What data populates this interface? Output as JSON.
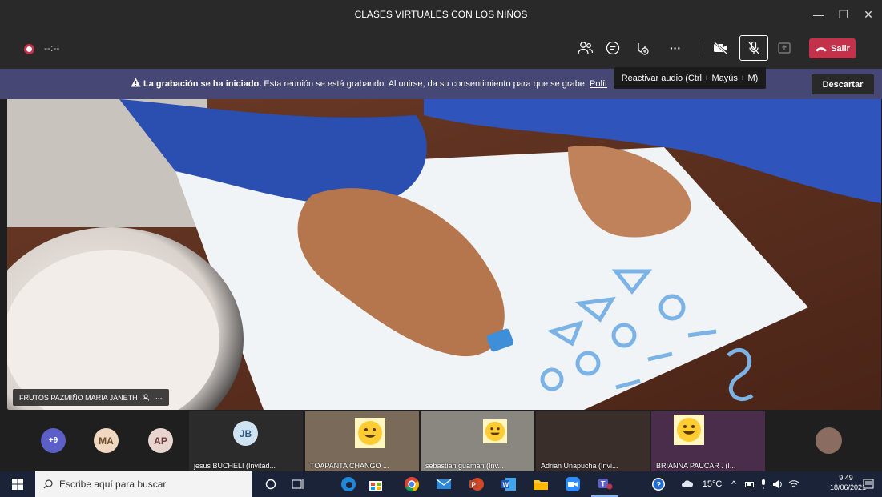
{
  "window": {
    "title": "CLASES VIRTUALES CON LOS NIÑOS",
    "minimize": "—",
    "maximize": "❐",
    "close": "✕"
  },
  "toolbar": {
    "recording_time": "--:--",
    "leave_label": "Salir",
    "more_label": "···"
  },
  "banner": {
    "bold": "La grabación se ha iniciado.",
    "text": " Esta reunión se está grabando. Al unirse, da su consentimiento para que se grabe. ",
    "link": "Polít",
    "dismiss": "Descartar"
  },
  "tooltip": "Reactivar audio (Ctrl + Mayús + M)",
  "main_video": {
    "participant": "FRUTOS PAZMIÑO MARIA JANETH",
    "more": "···"
  },
  "gallery": {
    "overflow_count": "+9",
    "avatars": [
      {
        "initials": "MA",
        "color": "#f0d8c0",
        "text_color": "#6b4a2a"
      },
      {
        "initials": "AP",
        "color": "#e8d5d0",
        "text_color": "#6b3a3a"
      }
    ],
    "tiles": [
      {
        "initials": "JB",
        "name": "jesus BUCHELI (Invitad..."
      },
      {
        "name": "TOAPANTA CHANGO ..."
      },
      {
        "name": "sebastian guaman (Inv..."
      },
      {
        "name": "Adrian Unapucha (Invi..."
      },
      {
        "name": "BRIANNA PAUCAR . (I..."
      }
    ]
  },
  "taskbar": {
    "search_placeholder": "Escribe aquí para buscar",
    "weather": "15°C",
    "time": "9:49",
    "date": "18/06/2021"
  }
}
